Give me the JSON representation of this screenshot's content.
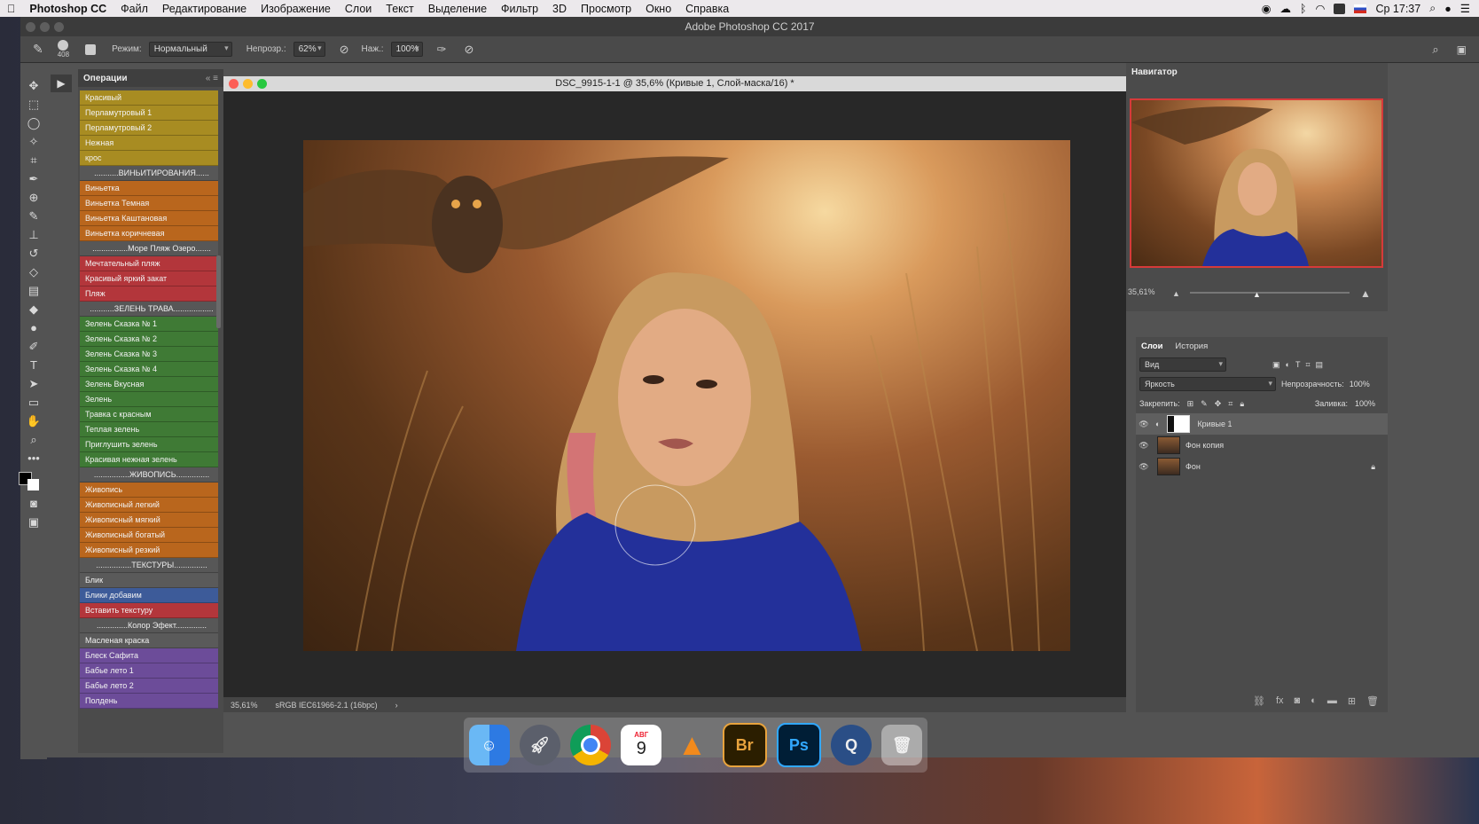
{
  "menubar": {
    "app": "Photoshop CC",
    "items": [
      "Файл",
      "Редактирование",
      "Изображение",
      "Слои",
      "Текст",
      "Выделение",
      "Фильтр",
      "3D",
      "Просмотр",
      "Окно",
      "Справка"
    ],
    "clock": "Ср 17:37"
  },
  "window": {
    "title": "Adobe Photoshop CC 2017"
  },
  "options": {
    "brush_size": "408",
    "mode_label": "Режим:",
    "mode_value": "Нормальный",
    "opacity_label": "Непрозр.:",
    "opacity_value": "62%",
    "pressure_label": "Наж.:",
    "pressure_value": "100%"
  },
  "actions": {
    "title": "Операции",
    "items": [
      {
        "label": "Красивый",
        "color": "yellow"
      },
      {
        "label": "Перламутровый 1",
        "color": "yellow"
      },
      {
        "label": "Перламутровый 2",
        "color": "yellow"
      },
      {
        "label": "Нежная",
        "color": "yellow"
      },
      {
        "label": "крос",
        "color": "yellow"
      },
      {
        "label": "...........ВИНЬИТИРОВАНИЯ......",
        "color": "none"
      },
      {
        "label": "Виньетка",
        "color": "orange"
      },
      {
        "label": "Виньетка Темная",
        "color": "orange"
      },
      {
        "label": "Виньетка Каштановая",
        "color": "orange"
      },
      {
        "label": "Виньетка коричневая",
        "color": "orange"
      },
      {
        "label": "................Море Пляж Озеро.......",
        "color": "none"
      },
      {
        "label": "Мечтательный пляж",
        "color": "red"
      },
      {
        "label": "Красивый яркий закат",
        "color": "red"
      },
      {
        "label": "Пляж",
        "color": "red"
      },
      {
        "label": "...........ЗЕЛЕНЬ ТРАВА..................",
        "color": "none"
      },
      {
        "label": "Зелень Сказка № 1",
        "color": "green"
      },
      {
        "label": "Зелень Сказка № 2",
        "color": "green"
      },
      {
        "label": "Зелень Сказка № 3",
        "color": "green"
      },
      {
        "label": "Зелень Сказка № 4",
        "color": "green"
      },
      {
        "label": "Зелень Вкусная",
        "color": "green"
      },
      {
        "label": "Зелень",
        "color": "green"
      },
      {
        "label": "Травка с красным",
        "color": "green"
      },
      {
        "label": "Теплая зелень",
        "color": "green"
      },
      {
        "label": "Приглушить зелень",
        "color": "green"
      },
      {
        "label": "Красивая нежная зелень",
        "color": "green"
      },
      {
        "label": "................ЖИВОПИСЬ...............",
        "color": "none"
      },
      {
        "label": "Живопись",
        "color": "orange"
      },
      {
        "label": "Живописный легкий",
        "color": "orange"
      },
      {
        "label": "Живописный мягкий",
        "color": "orange"
      },
      {
        "label": "Живописный богатый",
        "color": "orange"
      },
      {
        "label": "Живописный резкий",
        "color": "orange"
      },
      {
        "label": "................ТЕКСТУРЫ...............",
        "color": "none"
      },
      {
        "label": "Блик",
        "color": "gray"
      },
      {
        "label": "Блики добавим",
        "color": "blue"
      },
      {
        "label": "Вставить текстуру",
        "color": "red"
      },
      {
        "label": "..............Колор Эфект..............",
        "color": "none"
      },
      {
        "label": "Масленая краска",
        "color": "gray"
      },
      {
        "label": "Блеск Сафита",
        "color": "violet"
      },
      {
        "label": "Бабье лето 1",
        "color": "violet"
      },
      {
        "label": "Бабье лето 2",
        "color": "violet"
      },
      {
        "label": "Полдень",
        "color": "violet"
      }
    ]
  },
  "document": {
    "tab_title": "DSC_9915-1-1 @ 35,6% (Кривые 1, Слой-маска/16) *",
    "zoom": "35,61%",
    "profile": "sRGB IEC61966-2.1 (16bpc)"
  },
  "navigator": {
    "title": "Навигатор",
    "zoom": "35,61%"
  },
  "layers": {
    "tabs": [
      "Слои",
      "История"
    ],
    "filter_label": "Вид",
    "blend_mode": "Яркость",
    "opacity_label": "Непрозрачность:",
    "opacity_value": "100%",
    "lock_label": "Закрепить:",
    "fill_label": "Заливка:",
    "fill_value": "100%",
    "rows": [
      {
        "name": "Кривые 1",
        "selected": true
      },
      {
        "name": "Фон копия",
        "selected": false
      },
      {
        "name": "Фон",
        "selected": false
      }
    ]
  },
  "dock": {
    "calendar_month": "АВГ",
    "calendar_day": "9",
    "bridge": "Br",
    "photoshop": "Ps"
  },
  "colors": {
    "accent_red": "#d63a3a",
    "menubar_bg": "#ece9ec",
    "panel_bg": "#4b4b4b"
  }
}
